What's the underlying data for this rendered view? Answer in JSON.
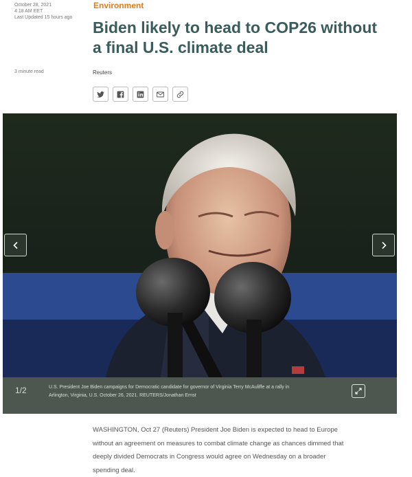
{
  "article": {
    "published_date": "October 28, 2021",
    "published_time": "4:18 AM EET",
    "last_updated": "Last Updated 15 hours ago",
    "read_time": "3 minute read",
    "section": "Environment",
    "headline": "Biden likely to head to COP26 without a final U.S. climate deal",
    "byline": "Reuters",
    "body": "WASHINGTON, Oct 27 (Reuters)    President Joe Biden is expected to head to Europe without an agreement on measures to combat climate change as chances dimmed that deeply divided Democrats in Congress would agree on Wednesday on a broader spending deal."
  },
  "share": {
    "icons": [
      "twitter-icon",
      "facebook-icon",
      "linkedin-icon",
      "email-icon",
      "link-icon"
    ]
  },
  "gallery": {
    "counter": "1/2",
    "caption": "U.S. President Joe Biden campaigns for Democratic candidate for governor of Virginia Terry McAuliffe at a rally in Arlington, Virginia, U.S. October 26, 2021. REUTERS/Jonathan Ernst",
    "image_subject": "photo of Joe Biden speaking at microphones"
  },
  "colors": {
    "section_accent": "#e87b14",
    "headline": "#3b5c5c",
    "gallery_bar": "#4d574f"
  }
}
